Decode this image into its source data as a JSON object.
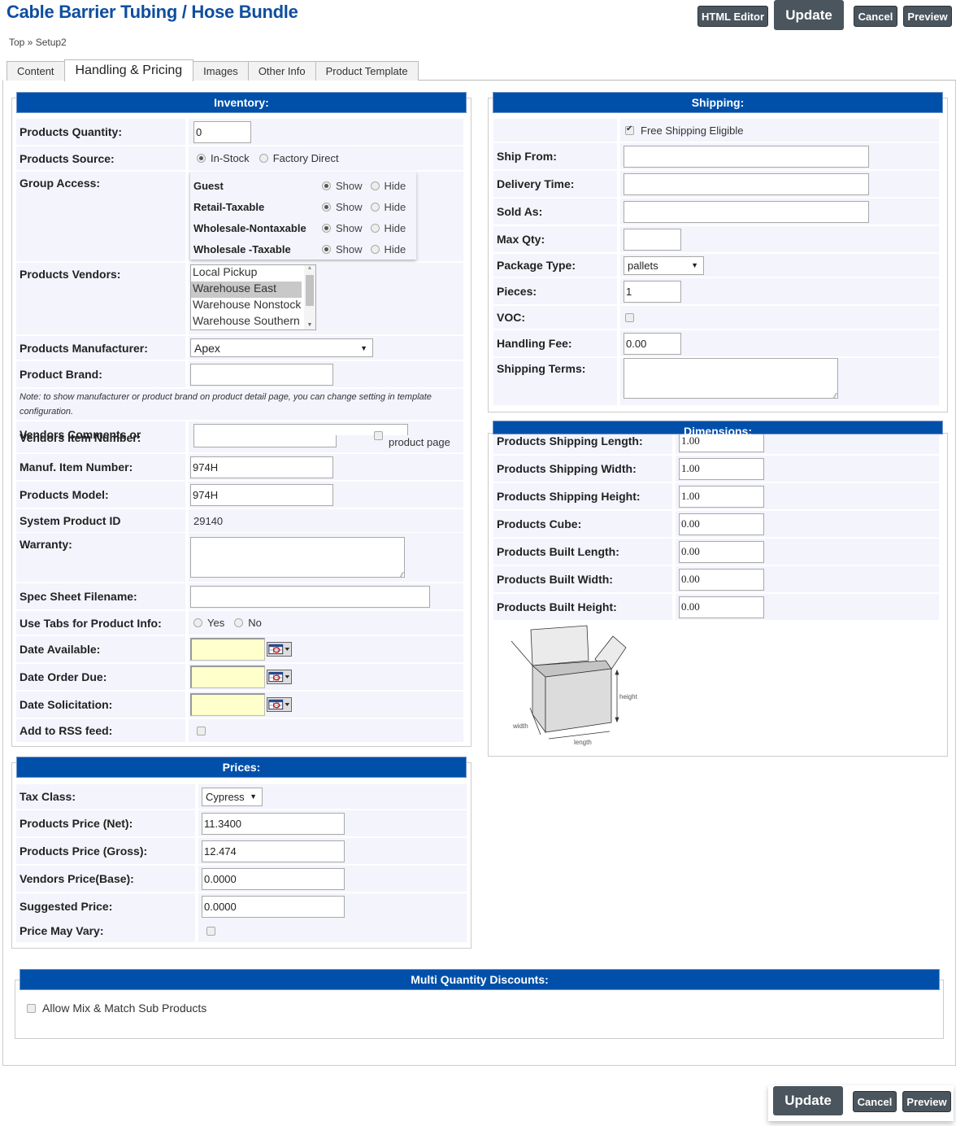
{
  "header": {
    "title": "Cable Barrier Tubing / Hose Bundle",
    "breadcrumb": "Top » Setup2",
    "buttons": {
      "html_editor": "HTML Editor",
      "update": "Update",
      "cancel": "Cancel",
      "preview": "Preview"
    }
  },
  "tabs": [
    "Content",
    "Handling & Pricing",
    "Images",
    "Other Info",
    "Product Template"
  ],
  "active_tab": "Handling & Pricing",
  "inventory": {
    "title": "Inventory:",
    "quantity_label": "Products Quantity:",
    "quantity": "0",
    "source_label": "Products Source:",
    "source_options": [
      "In-Stock",
      "Factory Direct"
    ],
    "source_selected": "In-Stock",
    "group_access_label": "Group Access:",
    "groups": [
      {
        "name": "Guest",
        "show": "Show",
        "hide": "Hide",
        "selected": "Show"
      },
      {
        "name": "Retail-Taxable",
        "show": "Show",
        "hide": "Hide",
        "selected": "Show"
      },
      {
        "name": "Wholesale-Nontaxable",
        "show": "Show",
        "hide": "Hide",
        "selected": "Show"
      },
      {
        "name": "Wholesale -Taxable",
        "show": "Show",
        "hide": "Hide",
        "selected": "Show"
      }
    ],
    "vendors_label": "Products Vendors:",
    "vendors": [
      "Local Pickup",
      "Warehouse East",
      "Warehouse Nonstock",
      "Warehouse Southern"
    ],
    "vendors_selected": "Warehouse East",
    "manufacturer_label": "Products Manufacturer:",
    "manufacturer": "Apex",
    "brand_label": "Product Brand:",
    "brand": "",
    "note": "Note: to show manufacturer or product brand on product detail page, you can change setting in template configuration.",
    "vendors_item_label": "Vendors Item Number:",
    "vendors_comments_label": "Vendors Comments or",
    "product_page_text": "product page",
    "manuf_item_label": "Manuf. Item Number:",
    "manuf_item": "974H",
    "model_label": "Products Model:",
    "model": "974H",
    "system_id_label": "System Product ID",
    "system_id": "29140",
    "warranty_label": "Warranty:",
    "spec_label": "Spec Sheet Filename:",
    "use_tabs_label": "Use Tabs for Product Info:",
    "use_tabs_options": [
      "Yes",
      "No"
    ],
    "date_available_label": "Date Available:",
    "date_order_due_label": "Date Order Due:",
    "date_solicitation_label": "Date Solicitation:",
    "rss_label": "Add to RSS feed:"
  },
  "shipping": {
    "title": "Shipping:",
    "free_shipping": "Free Shipping Eligible",
    "free_shipping_checked": true,
    "ship_from_label": "Ship From:",
    "delivery_label": "Delivery Time:",
    "sold_as_label": "Sold As:",
    "max_qty_label": "Max Qty:",
    "package_label": "Package Type:",
    "package": "pallets",
    "pieces_label": "Pieces:",
    "pieces": "1",
    "voc_label": "VOC:",
    "handling_label": "Handling Fee:",
    "handling": "0.00",
    "terms_label": "Shipping Terms:"
  },
  "dimensions": {
    "title": "Dimensions:",
    "rows": [
      {
        "label": "Products Shipping Length:",
        "value": "1.00"
      },
      {
        "label": "Products Shipping Width:",
        "value": "1.00"
      },
      {
        "label": "Products Shipping Height:",
        "value": "1.00"
      },
      {
        "label": "Products Cube:",
        "value": "0.00"
      },
      {
        "label": "Products Built Length:",
        "value": "0.00"
      },
      {
        "label": "Products Built Width:",
        "value": "0.00"
      },
      {
        "label": "Products Built Height:",
        "value": "0.00"
      }
    ],
    "diagram": {
      "height": "height",
      "width": "width",
      "length": "length"
    }
  },
  "prices": {
    "title": "Prices:",
    "tax_class_label": "Tax Class:",
    "tax_class": "Cypress",
    "rows": [
      {
        "label": "Products Price (Net):",
        "value": "11.3400"
      },
      {
        "label": "Products Price (Gross):",
        "value": "12.474"
      },
      {
        "label": "Vendors Price(Base):",
        "value": "0.0000"
      },
      {
        "label": "Suggested Price:",
        "value": "0.0000"
      }
    ],
    "vary_label": "Price May Vary:"
  },
  "multi_qty": {
    "title": "Multi Quantity Discounts:",
    "mix_match": "Allow Mix & Match Sub Products"
  }
}
